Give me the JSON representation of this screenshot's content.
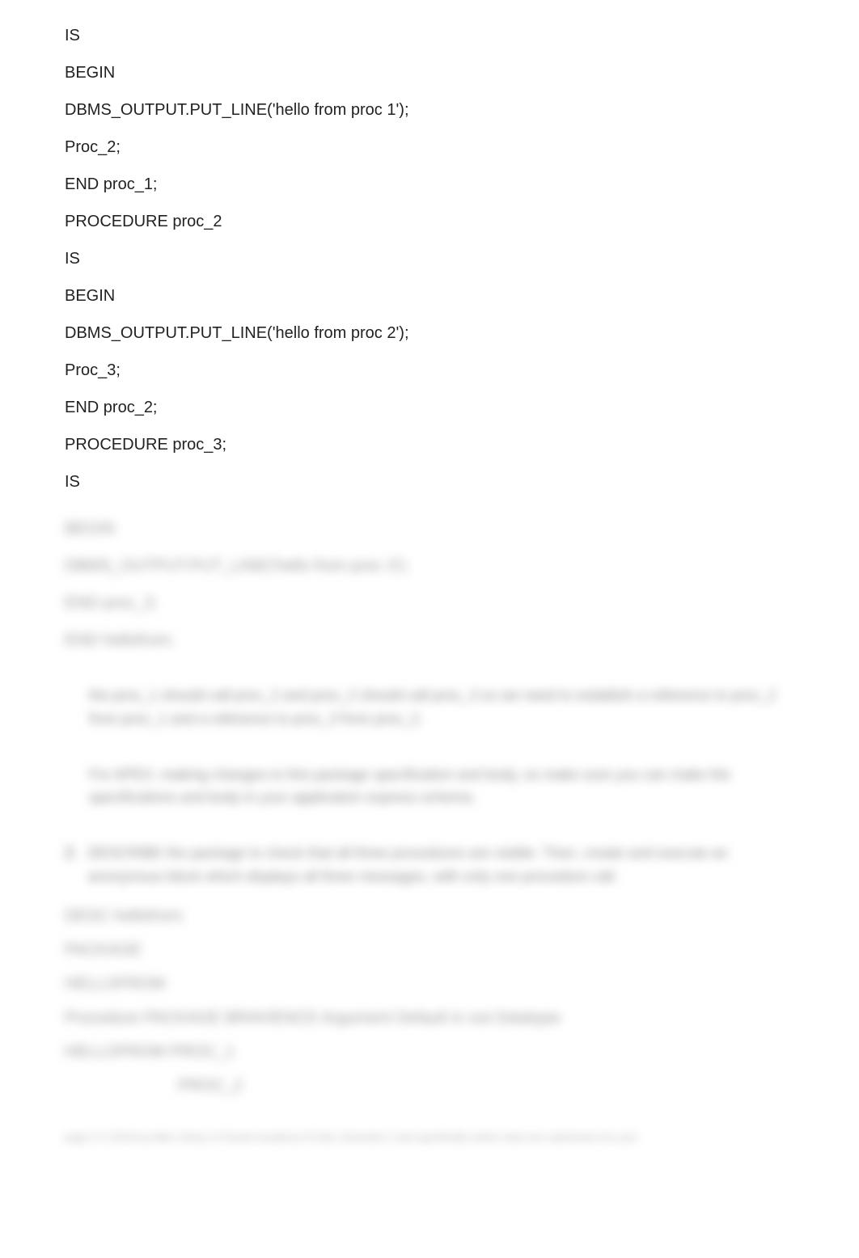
{
  "code": {
    "lines": [
      "IS",
      "BEGIN",
      "DBMS_OUTPUT.PUT_LINE('hello from proc 1');",
      "Proc_2;",
      "END proc_1;",
      "PROCEDURE proc_2",
      "IS",
      "BEGIN",
      "DBMS_OUTPUT.PUT_LINE('hello from proc 2');",
      "Proc_3;",
      "END proc_2;",
      "PROCEDURE proc_3;",
      "IS"
    ]
  },
  "blurred": {
    "lines": [
      "BEGIN",
      "DBMS_OUTPUT.PUT_LINE('hello from proc 3');",
      "END proc_3;",
      "END hellofrom;"
    ]
  },
  "paragraphs": {
    "p1": "the proc_1 should call proc_2 and proc_2 should call proc_3 so we need to establish a reference to proc_2 from proc_1 and a reference to proc_3 from proc_2.",
    "p2": "For APEX, making changes to this package specification and body, so make sure you can make the specifications and body in your application express schema."
  },
  "numbered": {
    "num": "2.",
    "text": "DESCRIBE the package to check that all three procedures are visible. Then, create and execute an anonymous block which displays all three messages, with only one procedure call."
  },
  "tail": {
    "lines": [
      "DESC hellofrom;",
      "PACKAGE",
      "HELLOFROM",
      "Procedure PACKAGE BRAVIENCE Argument Default in out Datatype",
      "HELLOFROM          PROC_1",
      "                   PROC_2"
    ]
  },
  "footnote": "page 2 © 2018 by Aidin Library of Oracle Academy PLSQL Semester 2 and specifically online class pre submission for your"
}
